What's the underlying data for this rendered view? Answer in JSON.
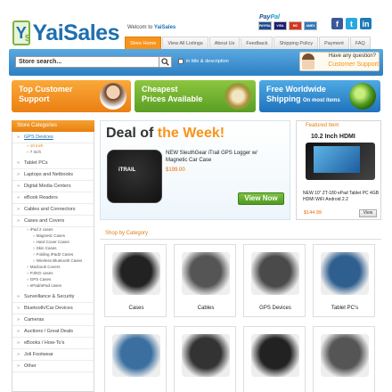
{
  "header": {
    "logo_text": "YaiSales",
    "logo_badge": "Y",
    "logo_badge_symbol": "$",
    "welcome_prefix": "Welcom to",
    "welcome_site": "YaiSales",
    "paypal_pay": "Pay",
    "paypal_pal": "Pal",
    "cards": [
      {
        "label": "PAYPAL",
        "color": "#1e4b93"
      },
      {
        "label": "VISA",
        "color": "#1a1f71"
      },
      {
        "label": "MC",
        "color": "#d9331c"
      },
      {
        "label": "AMEX",
        "color": "#2e77bb"
      }
    ],
    "social": [
      {
        "icon": "facebook-icon",
        "glyph": "f",
        "color": "#3b5998"
      },
      {
        "icon": "twitter-icon",
        "glyph": "t",
        "color": "#29a9e1"
      },
      {
        "icon": "linkedin-icon",
        "glyph": "in",
        "color": "#1e7bb6"
      }
    ],
    "nav": [
      "Store Home",
      "View All Listings",
      "About Us",
      "Feedback",
      "Shipping Policy",
      "Payment",
      "FAQ"
    ],
    "nav_active": 0
  },
  "search": {
    "placeholder": "Store search...",
    "checkbox_label": "in title & description",
    "support_question": "Have any question?",
    "support_link": "Customer Support"
  },
  "banners": [
    {
      "line1": "Top Customer",
      "line2": "Support"
    },
    {
      "line1": "Cheapest",
      "line2": "Prices Available"
    },
    {
      "line1": "Free Worldwide",
      "line2": "Shipping",
      "small": "On most items"
    }
  ],
  "sidebar": {
    "title": "Store Categories",
    "categories": [
      "GPS Devices",
      "Tablet PCs",
      "Laptops and Netbooks",
      "Digital Media Centers",
      "eBook Readers",
      "Cables and Connectors",
      "Cases and Covers",
      "Surveillance & Security",
      "Bluetooth/Car Devices",
      "Cameras",
      "Auctions / Great Deals",
      "eBooks / How-To's",
      "Joli Footwear",
      "Other"
    ],
    "gps_subs": [
      "10 Inch",
      "7 Inch"
    ],
    "case_subs": [
      "iPad 2 cases",
      "Magnetic Cases",
      "Hard Cover Cases",
      "Skin Cases",
      "Folding iPad2 Cases",
      "Wireless Bluetooth Cases",
      "Macbook Covers",
      "PJ/KD cases",
      "GPS Cases",
      "ePad/aPad cases"
    ]
  },
  "deal": {
    "title_prefix": "Deal of ",
    "title_highlight": "the Week!",
    "image_text": "iTRAIL",
    "description": "NEW SleuthGear iTrail GPS Logger w/ Magnetic Car Case",
    "price": "$199.00",
    "button": "View Now"
  },
  "featured": {
    "heading": "Featured Item",
    "title": "10.2 Inch HDMI",
    "description": "NEW 10\" ZT-180 ePad Tablet PC 4GB HDMI WiFi Android 2.2",
    "price": "$144.99",
    "button": "View"
  },
  "shop": {
    "title": "Shop by Category",
    "tiles": [
      {
        "label": "Cases",
        "color": "#222"
      },
      {
        "label": "Cables",
        "color": "#555"
      },
      {
        "label": "GPS Devices",
        "color": "#4a4a4a"
      },
      {
        "label": "Tablet PC's",
        "color": "#2f5f8f"
      },
      {
        "label": "",
        "color": "#3a6f9f"
      },
      {
        "label": "",
        "color": "#333"
      },
      {
        "label": "",
        "color": "#222"
      },
      {
        "label": "",
        "color": "#555"
      }
    ]
  }
}
